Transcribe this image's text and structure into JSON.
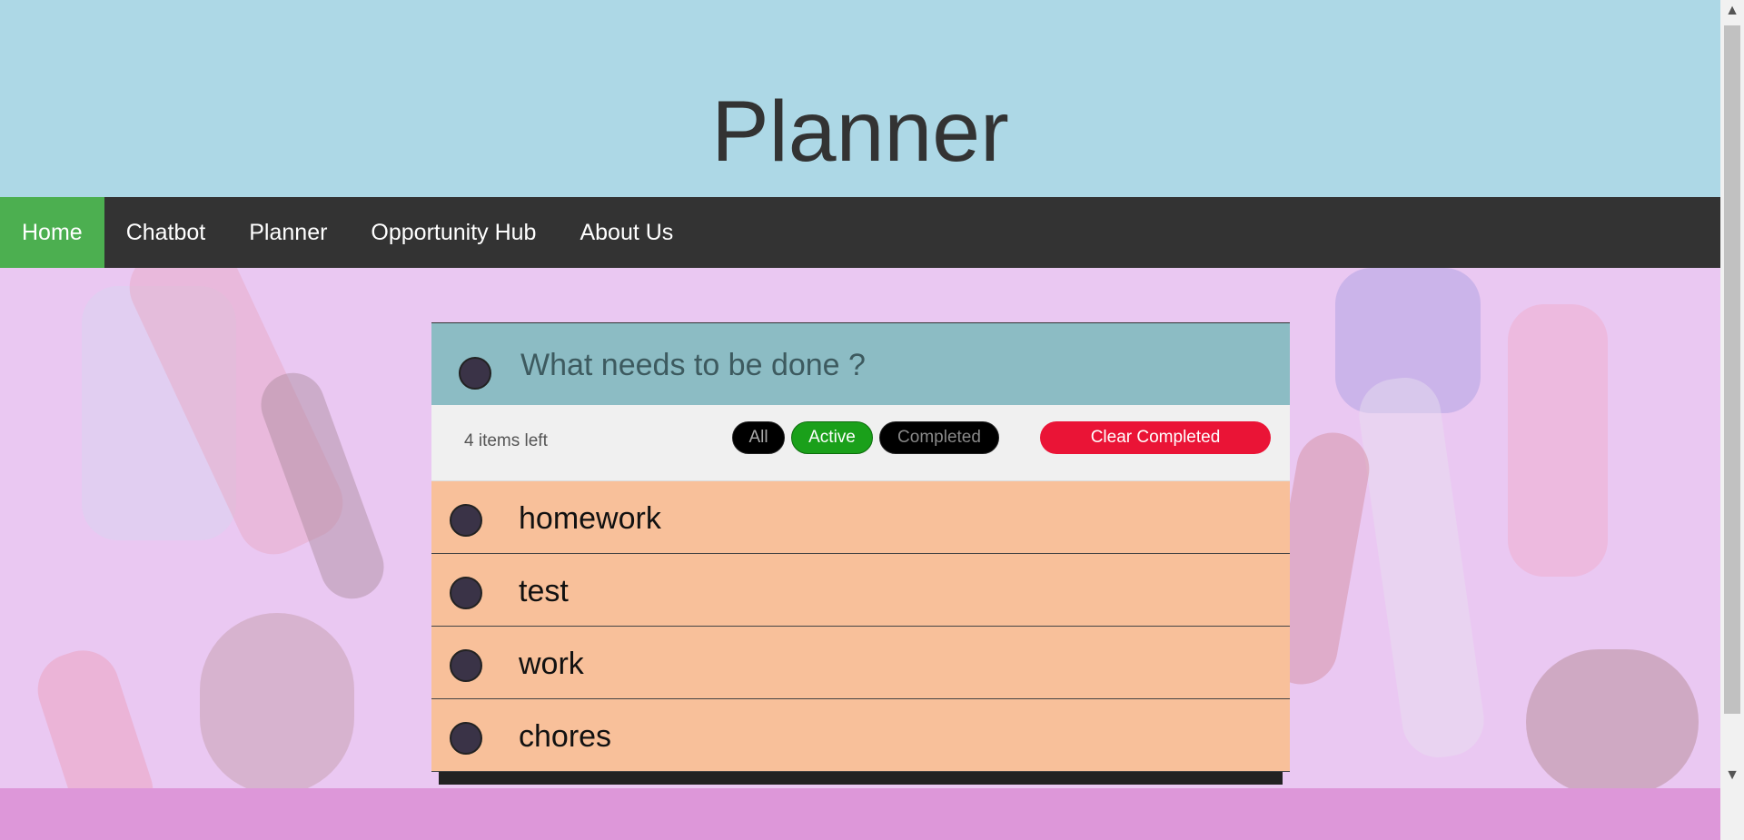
{
  "header": {
    "title": "Planner"
  },
  "nav": {
    "items": [
      {
        "label": "Home",
        "active": true
      },
      {
        "label": "Chatbot"
      },
      {
        "label": "Planner"
      },
      {
        "label": "Opportunity Hub"
      },
      {
        "label": "About Us"
      }
    ]
  },
  "todo": {
    "input_placeholder": "What needs to be done ?",
    "items_left": "4 items left",
    "filters": {
      "all": "All",
      "active": "Active",
      "completed": "Completed"
    },
    "clear_label": "Clear Completed",
    "items": [
      {
        "label": "homework"
      },
      {
        "label": "test"
      },
      {
        "label": "work"
      },
      {
        "label": "chores"
      }
    ]
  },
  "colors": {
    "header_bg": "#add8e6",
    "nav_bg": "#333333",
    "nav_active": "#4caf50",
    "input_row_bg": "#8cbcc4",
    "item_bg": "#f8c09a",
    "active_filter": "#1aa01a",
    "clear_button": "#ea1436",
    "page_bg": "#eac8f2"
  }
}
